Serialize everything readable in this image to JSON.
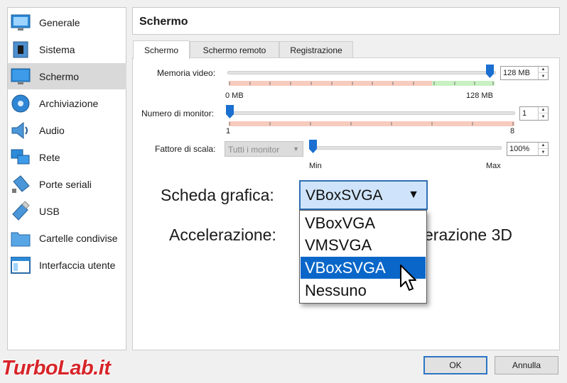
{
  "sidebar": {
    "items": [
      {
        "label": "Generale",
        "icon": "monitor-general-icon"
      },
      {
        "label": "Sistema",
        "icon": "chip-icon"
      },
      {
        "label": "Schermo",
        "icon": "display-icon",
        "active": true
      },
      {
        "label": "Archiviazione",
        "icon": "disk-icon"
      },
      {
        "label": "Audio",
        "icon": "speaker-icon"
      },
      {
        "label": "Rete",
        "icon": "network-icon"
      },
      {
        "label": "Porte seriali",
        "icon": "serial-port-icon"
      },
      {
        "label": "USB",
        "icon": "usb-icon"
      },
      {
        "label": "Cartelle condivise",
        "icon": "folder-icon"
      },
      {
        "label": "Interfaccia utente",
        "icon": "window-ui-icon"
      }
    ]
  },
  "header": {
    "title": "Schermo"
  },
  "tabs": [
    {
      "label": "Schermo",
      "active": true
    },
    {
      "label": "Schermo remoto",
      "active": false
    },
    {
      "label": "Registrazione",
      "active": false
    }
  ],
  "video_memory": {
    "label": "Memoria video:",
    "value": "128 MB",
    "min_label": "0 MB",
    "max_label": "128 MB",
    "level": 1.0
  },
  "monitors": {
    "label": "Numero di monitor:",
    "value": "1",
    "min_label": "1",
    "max_label": "8",
    "level": 0.0
  },
  "scale": {
    "label": "Fattore di scala:",
    "combo_value": "Tutti i monitor",
    "value": "100%",
    "min_label": "Min",
    "max_label": "Max",
    "level": 0.0
  },
  "graphics": {
    "label": "Scheda grafica:",
    "selected": "VBoxSVGA",
    "options": [
      "VBoxVGA",
      "VMSVGA",
      "VBoxSVGA",
      "Nessuno"
    ],
    "highlighted_index": 2
  },
  "acceleration": {
    "label": "Accelerazione:",
    "partial_text": "erazione 3D"
  },
  "buttons": {
    "ok": "OK",
    "cancel": "Annulla"
  },
  "watermark": {
    "text": "TurboLab.it"
  },
  "colors": {
    "accent": "#0a67c9",
    "slider_handle": "#1a6fd0",
    "watermark": "#d6252a"
  }
}
